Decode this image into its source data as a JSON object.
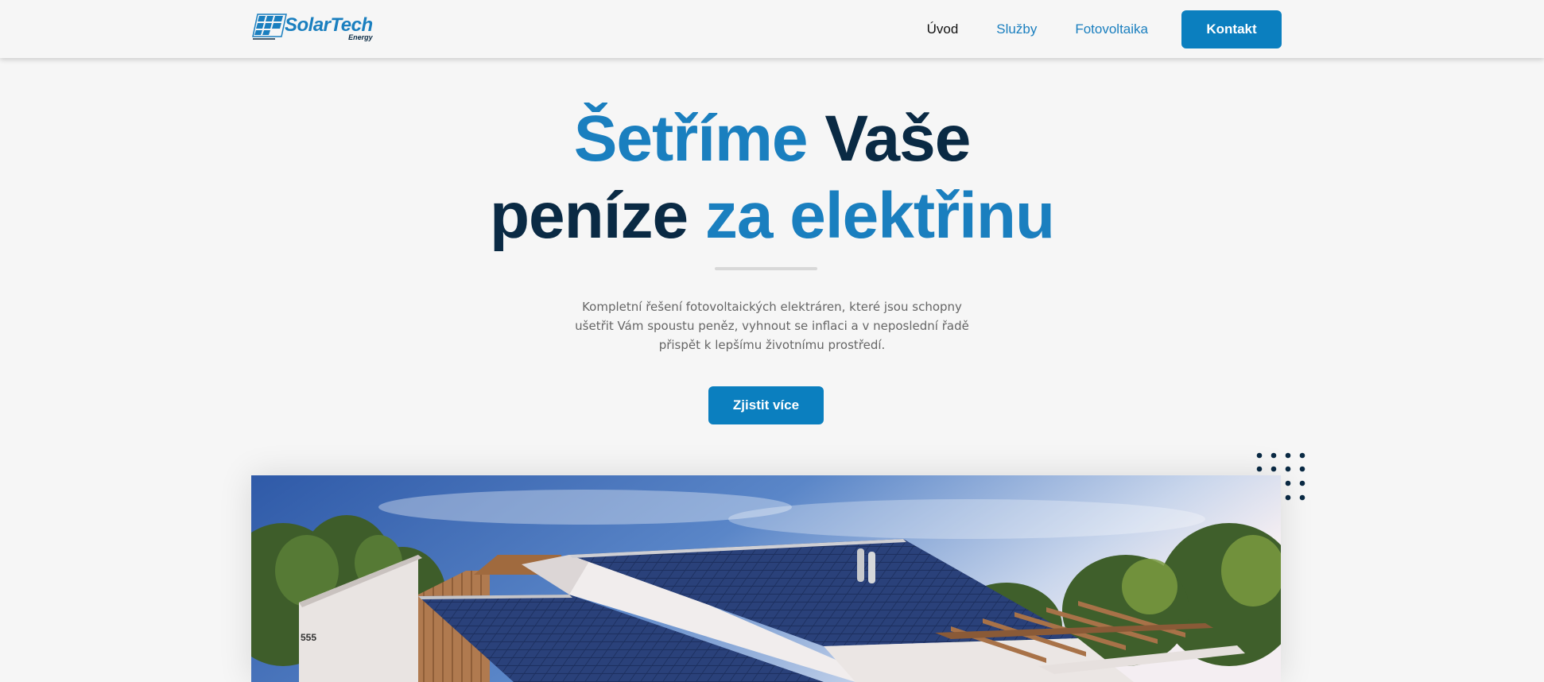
{
  "logo": {
    "brand": "SolarTech",
    "sub": "Energy"
  },
  "nav": {
    "items": [
      {
        "label": "Úvod",
        "active": true
      },
      {
        "label": "Služby",
        "active": false
      },
      {
        "label": "Fotovoltaika",
        "active": false
      }
    ],
    "cta": "Kontakt"
  },
  "hero": {
    "title_line1_accent": "Šetříme",
    "title_line1_rest": " Vaše",
    "title_line2_plain": "peníze ",
    "title_line2_accent": "za elektřinu",
    "description": "Kompletní řešení fotovoltaických elektráren, které jsou schopny ušetřit Vám spoustu peněz, vyhnout se inflaci a v neposlední řadě přispět k lepšímu životnímu prostředí.",
    "button": "Zjistit více"
  },
  "image": {
    "house_number": "555"
  },
  "colors": {
    "accent": "#1a7fbf",
    "dark": "#0a2a44",
    "button": "#0b7fbf",
    "background": "#f6f6f6"
  }
}
